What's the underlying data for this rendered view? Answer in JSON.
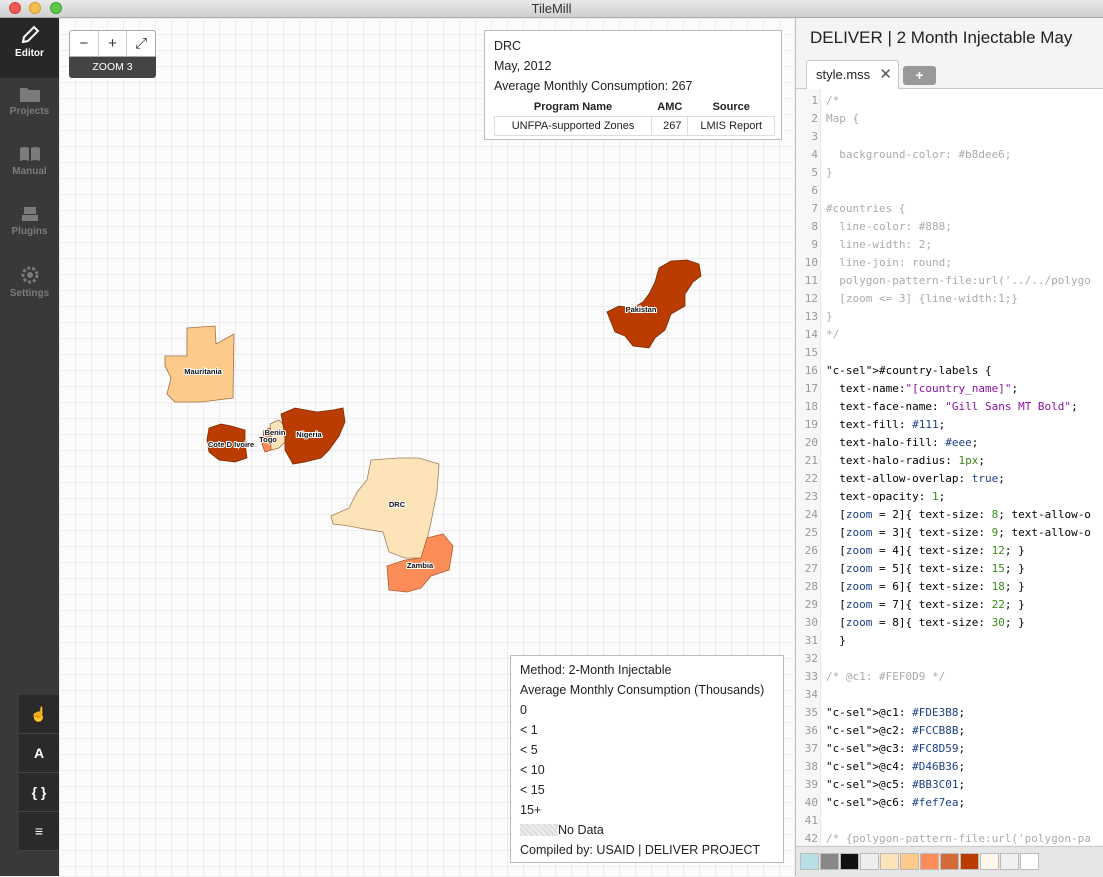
{
  "window": {
    "title": "TileMill"
  },
  "sidebar": {
    "items": [
      {
        "label": "Editor",
        "icon": "pencil-icon"
      },
      {
        "label": "Projects",
        "icon": "folder-icon"
      },
      {
        "label": "Manual",
        "icon": "book-icon"
      },
      {
        "label": "Plugins",
        "icon": "plugin-icon"
      },
      {
        "label": "Settings",
        "icon": "gear-icon"
      }
    ],
    "tools": [
      {
        "label": "☝",
        "icon": "hand-pointer-icon"
      },
      {
        "label": "A",
        "icon": "font-icon"
      },
      {
        "label": "{ }",
        "icon": "braces-icon"
      },
      {
        "label": "≡",
        "icon": "layers-icon"
      }
    ]
  },
  "map": {
    "zoom_out": "−",
    "zoom_in": "+",
    "fullscreen": "⤢",
    "zoom_label": "ZOOM 3",
    "country_labels": [
      "Pakistan",
      "Mauritania",
      "Benin",
      "Togo",
      "Nigeria",
      "Cote D Ivoire",
      "DRC",
      "Zambia"
    ],
    "tooltip": {
      "country": "DRC",
      "date": "May, 2012",
      "amc_line": "Average Monthly Consumption: 267",
      "headers": [
        "Program Name",
        "AMC",
        "Source"
      ],
      "rows": [
        [
          "UNFPA-supported Zones",
          "267",
          "LMIS Report"
        ]
      ]
    },
    "legend": {
      "method": "Method: 2-Month Injectable",
      "subtitle": "Average Monthly Consumption (Thousands)",
      "classes": [
        "0",
        "< 1",
        "< 5",
        "< 10",
        "< 15",
        "15+"
      ],
      "no_data": "No Data",
      "credit": "Compiled by: USAID | DELIVER PROJECT"
    }
  },
  "editor": {
    "project_title": "DELIVER | 2 Month Injectable May",
    "tab_label": "style.mss",
    "tab_close": "✕",
    "add_tab": "+",
    "lines": [
      "/*",
      "Map {",
      "",
      "  background-color: #b8dee6;",
      "}",
      "",
      "#countries {",
      "  line-color: #888;",
      "  line-width: 2;",
      "  line-join: round;",
      "  polygon-pattern-file:url('../../polygo",
      "  [zoom <= 3] {line-width:1;}",
      "}",
      "*/",
      "",
      "#country-labels {",
      "  text-name:\"[country_name]\";",
      "  text-face-name: \"Gill Sans MT Bold\";",
      "  text-fill: #111;",
      "  text-halo-fill: #eee;",
      "  text-halo-radius: 1px;",
      "  text-allow-overlap: true;",
      "  text-opacity: 1;",
      "  [zoom = 2]{ text-size: 8; text-allow-o",
      "  [zoom = 3]{ text-size: 9; text-allow-o",
      "  [zoom = 4]{ text-size: 12; }",
      "  [zoom = 5]{ text-size: 15; }",
      "  [zoom = 6]{ text-size: 18; }",
      "  [zoom = 7]{ text-size: 22; }",
      "  [zoom = 8]{ text-size: 30; }",
      "  }",
      "",
      "/* @c1: #FEF0D9 */",
      "",
      "@c1: #FDE3B8;",
      "@c2: #FCCB8B;",
      "@c3: #FC8D59;",
      "@c4: #D46B36;",
      "@c5: #BB3C01;",
      "@c6: #fef7ea;",
      "",
      "/* {polygon-pattern-file:url('polygon-pa"
    ],
    "palette": [
      "#b8dee6",
      "#888888",
      "#111111",
      "#eeeeee",
      "#fde3b8",
      "#fccb8b",
      "#fc8d59",
      "#d46b36",
      "#bb3c01",
      "#fef7ea",
      "#f0f0f0",
      "#ffffff"
    ]
  },
  "colors": {
    "pakistan": "#bb3c01",
    "mauritania": "#fccb8b",
    "nigeria": "#bb3c01",
    "benin": "#fde3b8",
    "togo": "#fc8d59",
    "cote_divoire": "#bb3c01",
    "drc": "#fde3b8",
    "zambia": "#fc8d59"
  }
}
